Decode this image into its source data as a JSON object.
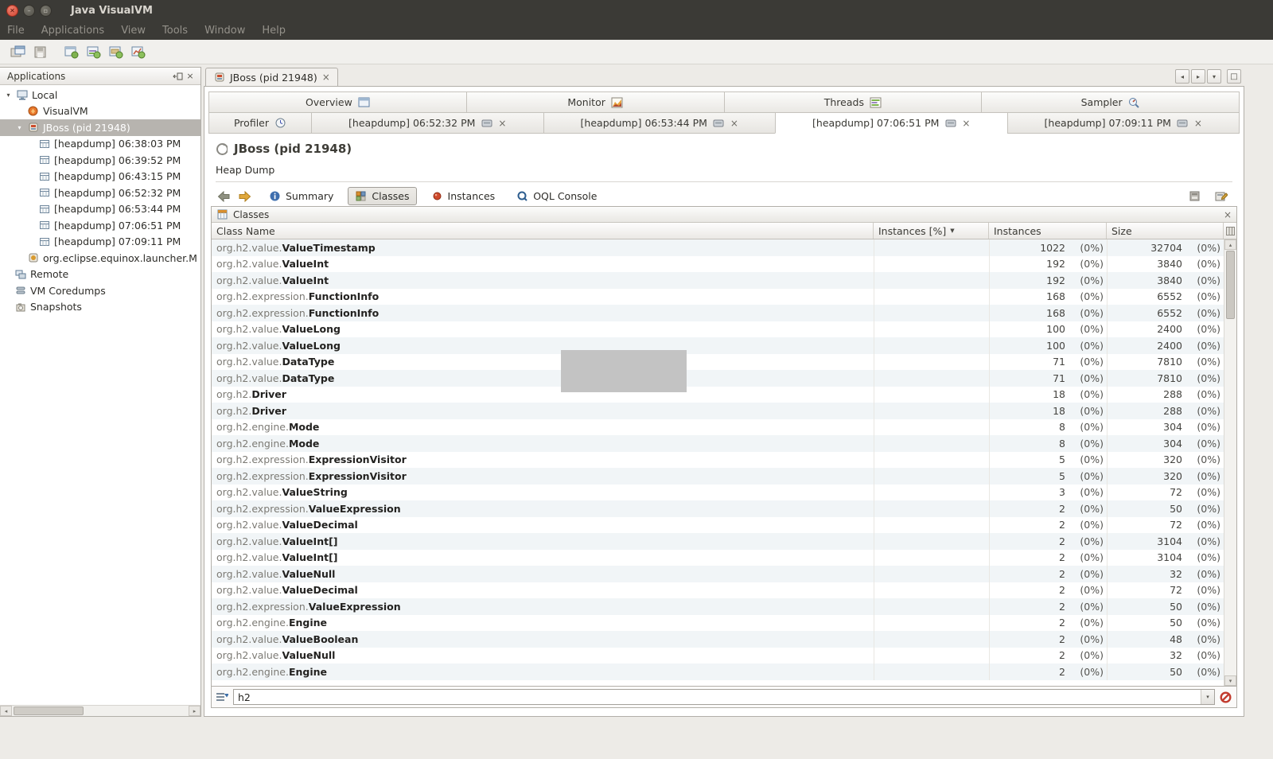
{
  "icons": {
    "close": "×",
    "window_close": "✕",
    "window_min": "–",
    "window_max": "▫",
    "sort_desc": "▼",
    "expander_open": "▾",
    "scroll_left": "◂",
    "scroll_right": "▸",
    "scroll_up": "▴",
    "scroll_down": "▾",
    "tab_prev": "◂",
    "tab_next": "▸",
    "tab_list": "▾",
    "maximize_view": "□",
    "dropdown": "▾"
  },
  "window": {
    "title": "Java VisualVM",
    "menus": [
      "File",
      "Applications",
      "View",
      "Tools",
      "Window",
      "Help"
    ]
  },
  "sidebar": {
    "title": "Applications",
    "local": "Local",
    "visualvm": "VisualVM",
    "jboss": "JBoss (pid 21948)",
    "heapdumps": [
      "[heapdump] 06:38:03 PM",
      "[heapdump] 06:39:52 PM",
      "[heapdump] 06:43:15 PM",
      "[heapdump] 06:52:32 PM",
      "[heapdump] 06:53:44 PM",
      "[heapdump] 07:06:51 PM",
      "[heapdump] 07:09:11 PM"
    ],
    "equinox": "org.eclipse.equinox.launcher.M",
    "remote": "Remote",
    "coredumps": "VM Coredumps",
    "snapshots": "Snapshots"
  },
  "doc": {
    "tab": "JBoss (pid 21948)",
    "view_tabs": [
      "Overview",
      "Monitor",
      "Threads",
      "Sampler"
    ],
    "sub_tabs": [
      "Profiler",
      "[heapdump] 06:52:32 PM",
      "[heapdump] 06:53:44 PM",
      "[heapdump] 07:06:51 PM",
      "[heapdump] 07:09:11 PM"
    ],
    "heading": "JBoss (pid 21948)",
    "section": "Heap Dump",
    "toolbar": {
      "summary": "Summary",
      "classes": "Classes",
      "instances": "Instances",
      "oql": "OQL Console"
    },
    "panel": {
      "title": "Classes",
      "columns": {
        "class_name": "Class Name",
        "instances_rel": "Instances [%]",
        "instances": "Instances",
        "size": "Size"
      },
      "filter_value": "h2",
      "rows": [
        {
          "pkg": "org.h2.value.",
          "cls": "ValueTimestamp",
          "inst": "1022",
          "ipct": "(0%)",
          "size": "32704",
          "spct": "(0%)"
        },
        {
          "pkg": "org.h2.value.",
          "cls": "ValueInt",
          "inst": "192",
          "ipct": "(0%)",
          "size": "3840",
          "spct": "(0%)"
        },
        {
          "pkg": "org.h2.value.",
          "cls": "ValueInt",
          "inst": "192",
          "ipct": "(0%)",
          "size": "3840",
          "spct": "(0%)"
        },
        {
          "pkg": "org.h2.expression.",
          "cls": "FunctionInfo",
          "inst": "168",
          "ipct": "(0%)",
          "size": "6552",
          "spct": "(0%)"
        },
        {
          "pkg": "org.h2.expression.",
          "cls": "FunctionInfo",
          "inst": "168",
          "ipct": "(0%)",
          "size": "6552",
          "spct": "(0%)"
        },
        {
          "pkg": "org.h2.value.",
          "cls": "ValueLong",
          "inst": "100",
          "ipct": "(0%)",
          "size": "2400",
          "spct": "(0%)"
        },
        {
          "pkg": "org.h2.value.",
          "cls": "ValueLong",
          "inst": "100",
          "ipct": "(0%)",
          "size": "2400",
          "spct": "(0%)"
        },
        {
          "pkg": "org.h2.value.",
          "cls": "DataType",
          "inst": "71",
          "ipct": "(0%)",
          "size": "7810",
          "spct": "(0%)"
        },
        {
          "pkg": "org.h2.value.",
          "cls": "DataType",
          "inst": "71",
          "ipct": "(0%)",
          "size": "7810",
          "spct": "(0%)"
        },
        {
          "pkg": "org.h2.",
          "cls": "Driver",
          "inst": "18",
          "ipct": "(0%)",
          "size": "288",
          "spct": "(0%)"
        },
        {
          "pkg": "org.h2.",
          "cls": "Driver",
          "inst": "18",
          "ipct": "(0%)",
          "size": "288",
          "spct": "(0%)"
        },
        {
          "pkg": "org.h2.engine.",
          "cls": "Mode",
          "inst": "8",
          "ipct": "(0%)",
          "size": "304",
          "spct": "(0%)"
        },
        {
          "pkg": "org.h2.engine.",
          "cls": "Mode",
          "inst": "8",
          "ipct": "(0%)",
          "size": "304",
          "spct": "(0%)"
        },
        {
          "pkg": "org.h2.expression.",
          "cls": "ExpressionVisitor",
          "inst": "5",
          "ipct": "(0%)",
          "size": "320",
          "spct": "(0%)"
        },
        {
          "pkg": "org.h2.expression.",
          "cls": "ExpressionVisitor",
          "inst": "5",
          "ipct": "(0%)",
          "size": "320",
          "spct": "(0%)"
        },
        {
          "pkg": "org.h2.value.",
          "cls": "ValueString",
          "inst": "3",
          "ipct": "(0%)",
          "size": "72",
          "spct": "(0%)"
        },
        {
          "pkg": "org.h2.expression.",
          "cls": "ValueExpression",
          "inst": "2",
          "ipct": "(0%)",
          "size": "50",
          "spct": "(0%)"
        },
        {
          "pkg": "org.h2.value.",
          "cls": "ValueDecimal",
          "inst": "2",
          "ipct": "(0%)",
          "size": "72",
          "spct": "(0%)"
        },
        {
          "pkg": "org.h2.value.",
          "cls": "ValueInt[]",
          "inst": "2",
          "ipct": "(0%)",
          "size": "3104",
          "spct": "(0%)"
        },
        {
          "pkg": "org.h2.value.",
          "cls": "ValueInt[]",
          "inst": "2",
          "ipct": "(0%)",
          "size": "3104",
          "spct": "(0%)"
        },
        {
          "pkg": "org.h2.value.",
          "cls": "ValueNull",
          "inst": "2",
          "ipct": "(0%)",
          "size": "32",
          "spct": "(0%)"
        },
        {
          "pkg": "org.h2.value.",
          "cls": "ValueDecimal",
          "inst": "2",
          "ipct": "(0%)",
          "size": "72",
          "spct": "(0%)"
        },
        {
          "pkg": "org.h2.expression.",
          "cls": "ValueExpression",
          "inst": "2",
          "ipct": "(0%)",
          "size": "50",
          "spct": "(0%)"
        },
        {
          "pkg": "org.h2.engine.",
          "cls": "Engine",
          "inst": "2",
          "ipct": "(0%)",
          "size": "50",
          "spct": "(0%)"
        },
        {
          "pkg": "org.h2.value.",
          "cls": "ValueBoolean",
          "inst": "2",
          "ipct": "(0%)",
          "size": "48",
          "spct": "(0%)"
        },
        {
          "pkg": "org.h2.value.",
          "cls": "ValueNull",
          "inst": "2",
          "ipct": "(0%)",
          "size": "32",
          "spct": "(0%)"
        },
        {
          "pkg": "org.h2.engine.",
          "cls": "Engine",
          "inst": "2",
          "ipct": "(0%)",
          "size": "50",
          "spct": "(0%)"
        }
      ]
    }
  }
}
